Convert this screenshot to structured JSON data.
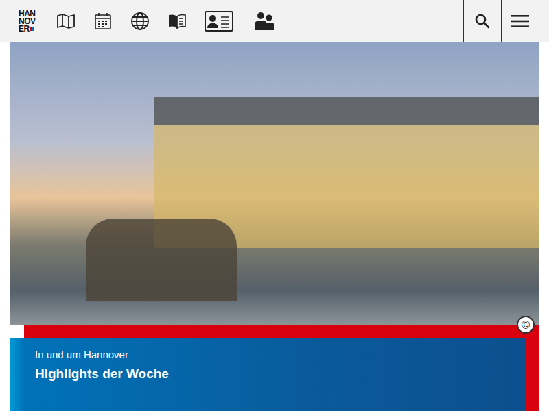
{
  "logo": {
    "lines": [
      "HAN",
      "NOV",
      "ER"
    ]
  },
  "hero": {
    "copyright": "©",
    "kicker": "In und um Hannover",
    "title": "Highlights der Woche"
  }
}
